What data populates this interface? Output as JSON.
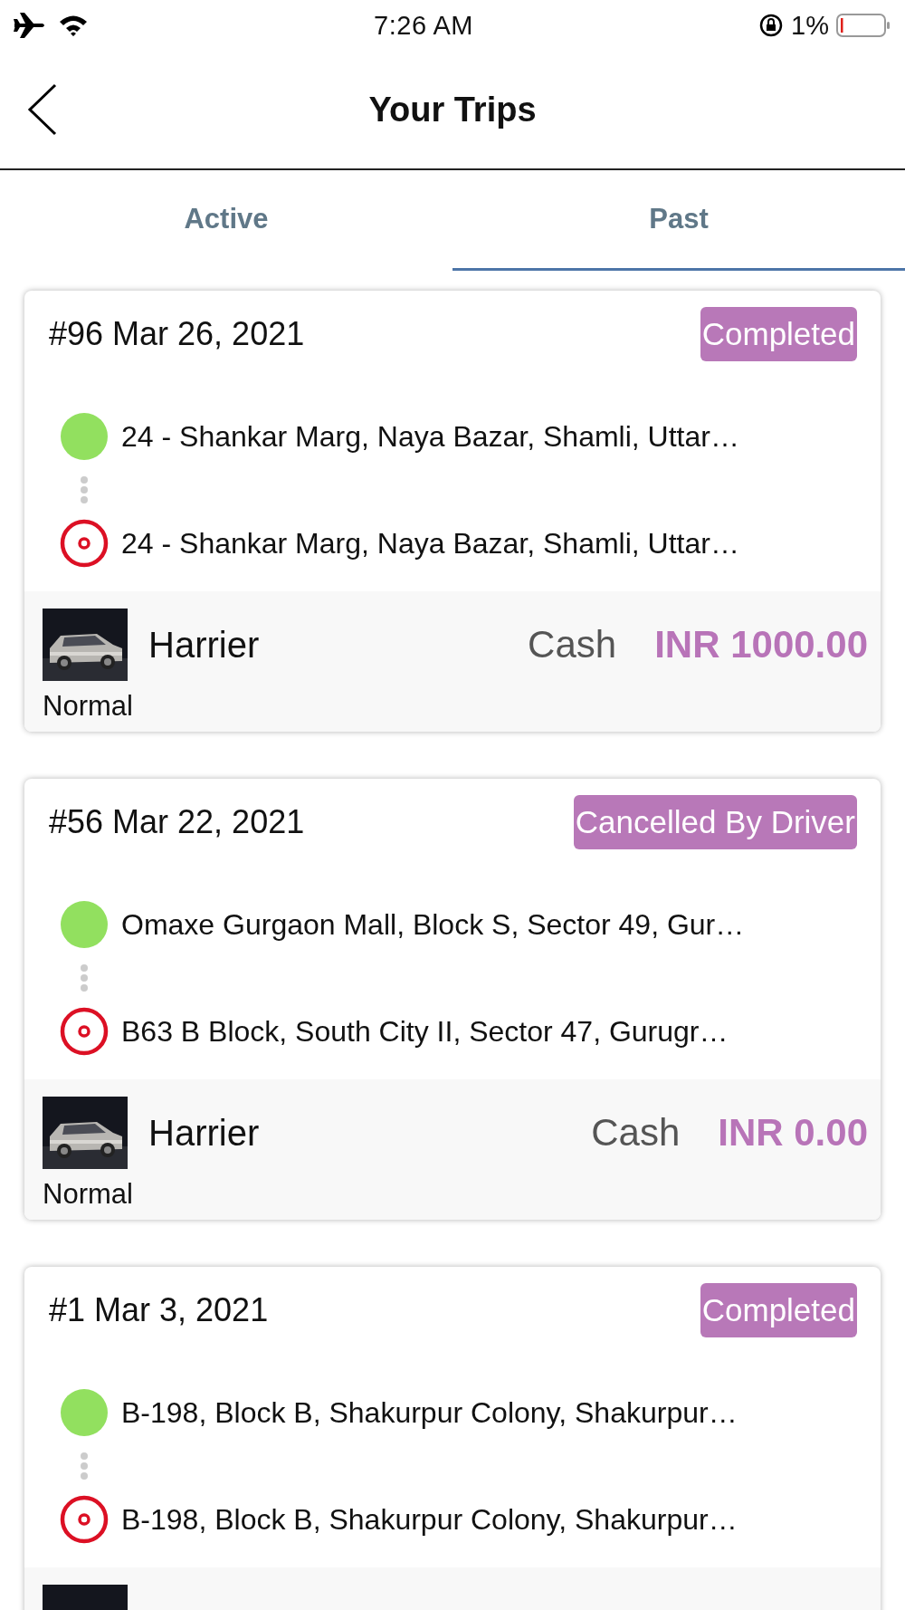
{
  "status_bar": {
    "time": "7:26 AM",
    "battery": "1%"
  },
  "nav": {
    "title": "Your Trips"
  },
  "tabs": [
    {
      "label": "Active",
      "selected": false
    },
    {
      "label": "Past",
      "selected": true
    }
  ],
  "trips": [
    {
      "title": "#96 Mar 26, 2021",
      "status": "Completed",
      "stops": [
        {
          "kind": "pickup",
          "address": "24 - Shankar Marg, Naya Bazar, Shamli, Uttar…"
        },
        {
          "kind": "dropoff",
          "address": "24 - Shankar Marg, Naya Bazar, Shamli, Uttar…"
        }
      ],
      "footer": {
        "picture": {
          "kind": "picture"
        },
        "vehicle": "Harrier",
        "payment": "Cash",
        "fare": "INR 1000.00",
        "category": "Normal"
      }
    },
    {
      "title": "#56 Mar 22, 2021",
      "status": "Cancelled By Driver",
      "stops": [
        {
          "kind": "pickup",
          "address": "Omaxe Gurgaon Mall, Block S, Sector 49, Gur…"
        },
        {
          "kind": "dropoff",
          "address": "B63 B Block, South City II, Sector 47, Gurugr…"
        }
      ],
      "footer": {
        "picture": {
          "kind": "picture"
        },
        "vehicle": "Harrier",
        "payment": "Cash",
        "fare": "INR 0.00",
        "category": "Normal"
      }
    },
    {
      "title": "#1 Mar 3, 2021",
      "status": "Completed",
      "stops": [
        {
          "kind": "pickup",
          "address": "B-198, Block B, Shakurpur Colony, Shakurpur…"
        },
        {
          "kind": "dropoff",
          "address": "B-198, Block B, Shakurpur Colony, Shakurpur…"
        }
      ],
      "footer": {
        "picture": {
          "kind": "picture"
        }
      }
    }
  ]
}
